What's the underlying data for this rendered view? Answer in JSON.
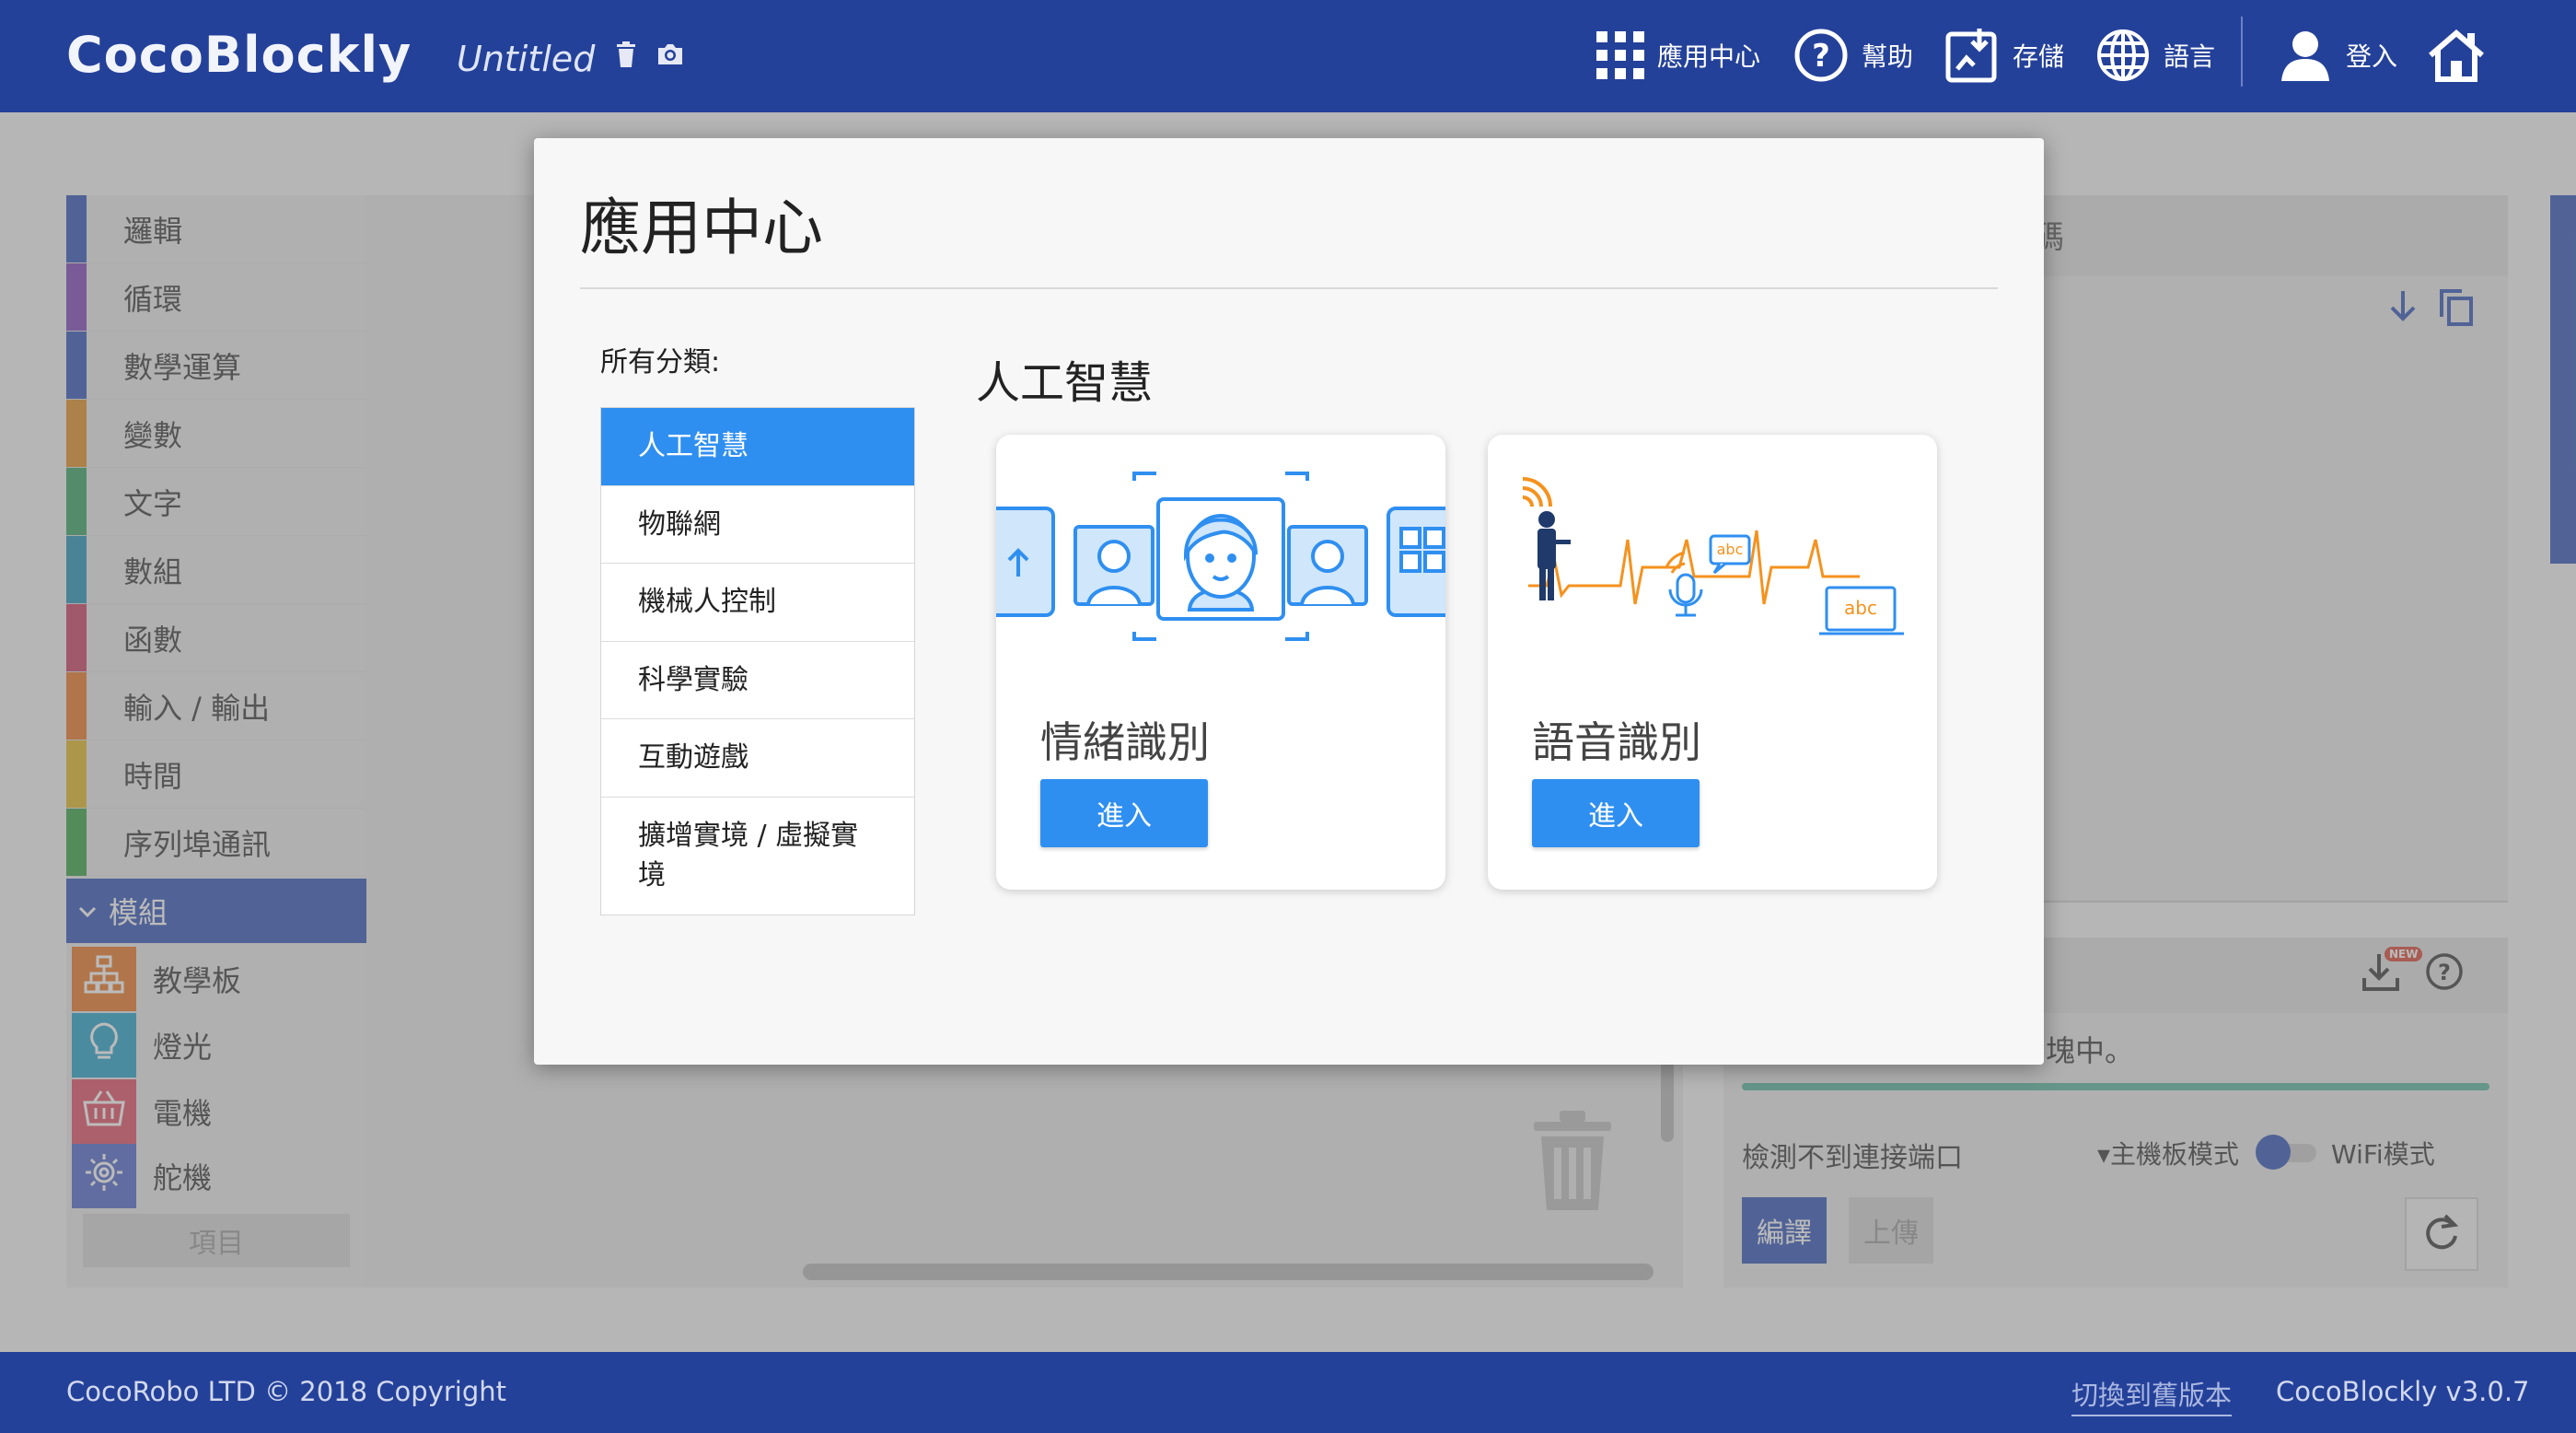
{
  "header": {
    "brand": "CocoBlockly",
    "project_name": "Untitled",
    "nav": [
      {
        "label": "應用中心",
        "icon": "grid-icon"
      },
      {
        "label": "幫助",
        "icon": "help-icon"
      },
      {
        "label": "存儲",
        "icon": "save-icon"
      },
      {
        "label": "語言",
        "icon": "globe-icon"
      },
      {
        "label": "登入",
        "icon": "user-icon"
      }
    ]
  },
  "sidebar": {
    "categories": [
      {
        "label": "邏輯",
        "color": "#2a4fb4"
      },
      {
        "label": "循環",
        "color": "#7b3fb8"
      },
      {
        "label": "數學運算",
        "color": "#2a4fb4"
      },
      {
        "label": "變數",
        "color": "#e08a1c"
      },
      {
        "label": "文字",
        "color": "#2e9e5e"
      },
      {
        "label": "數組",
        "color": "#1e8fb5"
      },
      {
        "label": "函數",
        "color": "#c9395f"
      },
      {
        "label": "輸入 / 輸出",
        "color": "#e8731c"
      },
      {
        "label": "時間",
        "color": "#e0b51c"
      },
      {
        "label": "序列埠通訊",
        "color": "#2e9e3e"
      }
    ],
    "modules_label": "模組",
    "modules": [
      {
        "label": "教學板",
        "color": "#e8731c",
        "icon": "board-icon"
      },
      {
        "label": "燈光",
        "color": "#1e9fc9",
        "icon": "bulb-icon"
      },
      {
        "label": "電機",
        "color": "#e0485f",
        "icon": "motor-icon"
      },
      {
        "label": "舵機",
        "color": "#4a63c9",
        "icon": "servo-icon"
      }
    ],
    "items_button": "項目"
  },
  "code_panel": {
    "title_fragment": "碼"
  },
  "console": {
    "message_fragment": "塊中。",
    "port_status": "檢測不到連接端口",
    "board_mode": "▾主機板模式",
    "wifi_mode": "WiFi模式",
    "compile_label": "編譯",
    "upload_label": "上傳",
    "new_badge": "NEW"
  },
  "modal": {
    "title": "應用中心",
    "all_categories_label": "所有分類:",
    "categories": [
      {
        "label": "人工智慧",
        "active": true
      },
      {
        "label": "物聯網",
        "active": false
      },
      {
        "label": "機械人控制",
        "active": false
      },
      {
        "label": "科學實驗",
        "active": false
      },
      {
        "label": "互動遊戲",
        "active": false
      },
      {
        "label": "擴增實境 / 虛擬實境",
        "active": false
      }
    ],
    "section_title": "人工智慧",
    "apps": [
      {
        "name": "情緒識別",
        "button": "進入",
        "illustration": "face-recognition-illustration"
      },
      {
        "name": "語音識別",
        "button": "進入",
        "illustration": "speech-recognition-illustration",
        "waveform_label_1": "abc",
        "waveform_label_2": "abc"
      }
    ]
  },
  "footer": {
    "copyright": "CocoRobo LTD © 2018 Copyright",
    "old_version_link": "切換到舊版本",
    "version": "CocoBlockly v3.0.7"
  },
  "colors": {
    "header_bg": "#24419a",
    "accent_blue": "#2f8ff0",
    "speech_orange": "#f5921e"
  }
}
